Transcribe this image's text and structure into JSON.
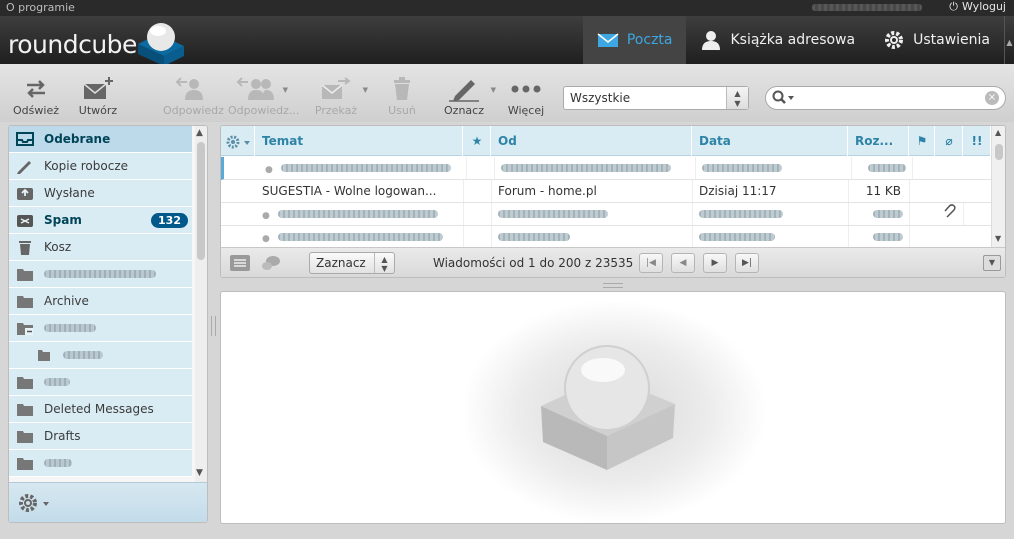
{
  "topline": {
    "about": "O programie",
    "logout": "Wyloguj"
  },
  "taskbar": [
    {
      "label": "Poczta",
      "icon": "envelope-icon",
      "active": true
    },
    {
      "label": "Książka adresowa",
      "icon": "person-icon",
      "active": false
    },
    {
      "label": "Ustawienia",
      "icon": "gear-icon",
      "active": false
    }
  ],
  "brand": {
    "name": "roundcube",
    "accent": "#3ea6e0",
    "highlight": "#00598a"
  },
  "toolbar": {
    "refresh": "Odśwież",
    "compose": "Utwórz",
    "reply": "Odpowiedz",
    "reply_all": "Odpowiedz...",
    "forward": "Przekaż",
    "delete": "Usuń",
    "mark": "Oznacz",
    "more": "Więcej",
    "filter_value": "Wszystkie",
    "search_value": ""
  },
  "folders": {
    "items": [
      {
        "label": "Odebrane",
        "icon": "inbox-icon"
      },
      {
        "label": "Kopie robocze",
        "icon": "pencil-icon"
      },
      {
        "label": "Wysłane",
        "icon": "sent-icon"
      },
      {
        "label": "Spam",
        "icon": "spam-icon",
        "count": "132"
      },
      {
        "label": "Kosz",
        "icon": "trash-icon"
      },
      {
        "label": "Archive",
        "icon": "folder-icon"
      },
      {
        "label": "Deleted Messages",
        "icon": "folder-icon"
      },
      {
        "label": "Drafts",
        "icon": "folder-icon"
      }
    ]
  },
  "messages": {
    "columns": {
      "subject": "Temat",
      "from": "Od",
      "date": "Data",
      "size": "Roz..."
    },
    "rows": [
      {
        "subject": "SUGESTIA - Wolne logowan...",
        "from": "Forum - home.pl",
        "date": "Dzisiaj 11:17",
        "size": "11 KB"
      }
    ],
    "select_label": "Zaznacz",
    "count_text": "Wiadomości od 1 do 200 z 23535"
  }
}
